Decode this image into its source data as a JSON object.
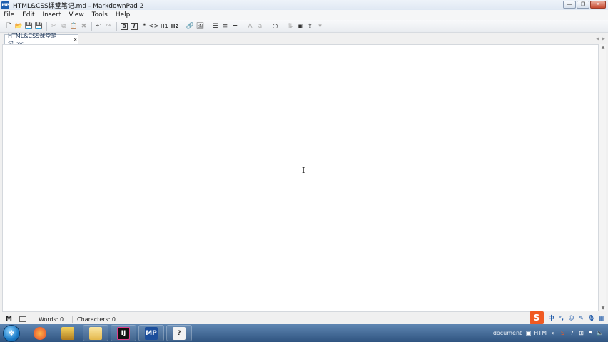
{
  "window": {
    "app_icon_text": "MP",
    "title": "HTML&CSS课堂笔记.md - MarkdownPad 2",
    "controls": {
      "minimize": "—",
      "maximize": "❐",
      "close": "✕"
    }
  },
  "menu": [
    {
      "id": "file",
      "label": "File"
    },
    {
      "id": "edit",
      "label": "Edit"
    },
    {
      "id": "insert",
      "label": "Insert"
    },
    {
      "id": "view",
      "label": "View"
    },
    {
      "id": "tools",
      "label": "Tools"
    },
    {
      "id": "help",
      "label": "Help"
    }
  ],
  "toolbar": {
    "h1_label": "H1",
    "h2_label": "H2",
    "bold_label": "B",
    "italic_label": "I",
    "uppercase_label": "A",
    "lowercase_label": "a"
  },
  "tab": {
    "label": "HTML&CSS课堂笔记.md",
    "close": "×"
  },
  "status": {
    "markdown_icon": "M",
    "words": "Words: 0",
    "characters": "Characters: 0"
  },
  "ime": {
    "logo": "S",
    "mode": "中"
  },
  "taskbar": {
    "ide_label": "IJ",
    "markdownpad_label": "MP",
    "help_label": "?",
    "tray_text1": "document",
    "tray_text2": "HTM"
  },
  "colors": {
    "titlebar": "#dfe8f3",
    "taskbar": "#2f5480",
    "ime_accent": "#f05a22",
    "tab_text": "#243b5c"
  }
}
